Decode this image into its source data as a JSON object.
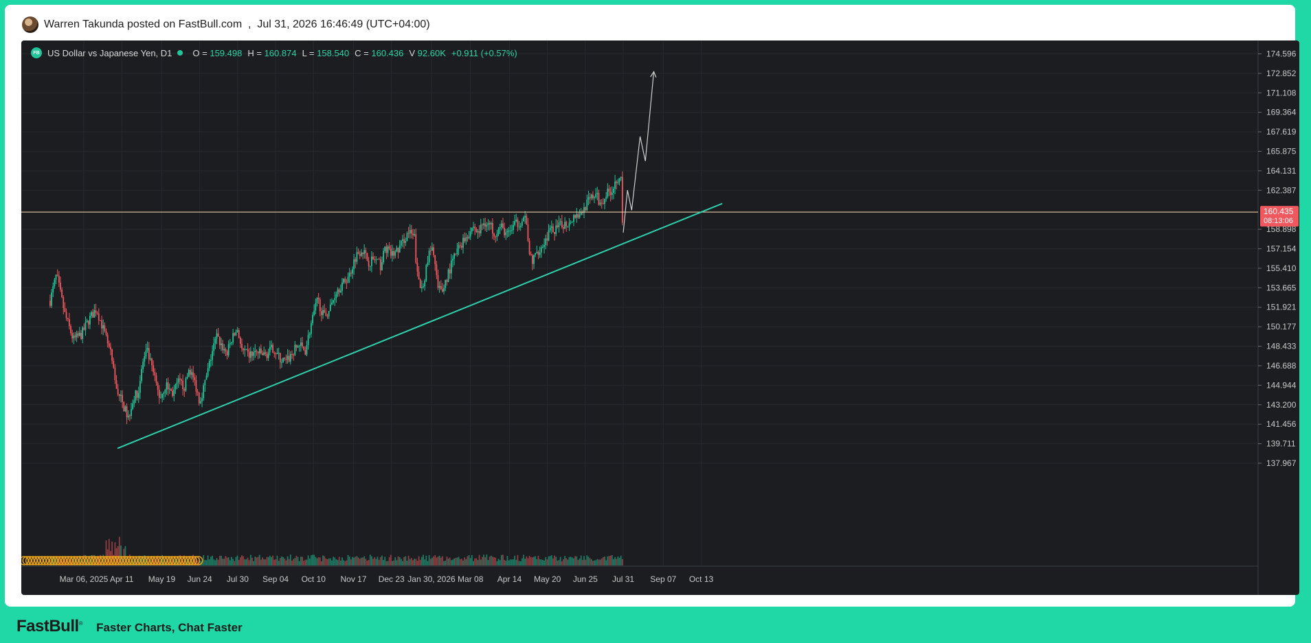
{
  "header": {
    "post_line": "Warren Takunda posted on FastBull.com  ,  Jul 31, 2026 16:46:49 (UTC+04:00)"
  },
  "legend": {
    "badge": "FB",
    "symbol": "US Dollar vs Japanese Yen, D1",
    "o_label": "O =",
    "o_value": "159.498",
    "h_label": "H =",
    "h_value": "160.874",
    "l_label": "L =",
    "l_value": "158.540",
    "c_label": "C =",
    "c_value": "160.436",
    "v_label": "V",
    "v_value": "92.60K",
    "change": "+0.911 (+0.57%)"
  },
  "footer": {
    "brand": "FastBull",
    "brand_mark": "®",
    "tagline": "Faster Charts, Chat Faster"
  },
  "colors": {
    "up": "#22c69a",
    "down": "#f0585f",
    "background": "#1b1d21",
    "price_line": "#e8c9a0",
    "trendline": "#2ed3ad",
    "projection": "#d0d0d0",
    "label_bg": "#f0585f"
  },
  "chart_data": {
    "type": "candlestick",
    "symbol": "US Dollar vs Japanese Yen",
    "timeframe": "D1",
    "ylim": [
      136.8,
      175.3
    ],
    "y_ticks": [
      "174.596",
      "172.852",
      "171.108",
      "169.364",
      "167.619",
      "165.875",
      "164.131",
      "162.387",
      "158.898",
      "157.154",
      "155.410",
      "153.665",
      "151.921",
      "150.177",
      "148.433",
      "146.688",
      "144.944",
      "143.200",
      "141.456",
      "139.711",
      "137.967"
    ],
    "x_ticks": [
      "Mar 06, 2025",
      "Apr 11",
      "May 19",
      "Jun 24",
      "Jul 30",
      "Sep 04",
      "Oct 10",
      "Nov 17",
      "Dec 23",
      "Jan 30, 2026",
      "Mar 08",
      "Apr 14",
      "May 20",
      "Jun 25",
      "Jul 31",
      "Sep 07",
      "Oct 13"
    ],
    "x_tick_offsets_days": [
      0,
      36,
      74,
      110,
      146,
      182,
      218,
      256,
      292,
      330,
      367,
      404,
      440,
      476,
      512,
      550,
      586
    ],
    "price_close_path": [
      {
        "d": -32,
        "p": 152.5
      },
      {
        "d": -26,
        "p": 154.8
      },
      {
        "d": -18,
        "p": 151.3
      },
      {
        "d": -10,
        "p": 149.0
      },
      {
        "d": -2,
        "p": 149.5
      },
      {
        "d": 4,
        "p": 150.7
      },
      {
        "d": 12,
        "p": 151.8
      },
      {
        "d": 20,
        "p": 149.5
      },
      {
        "d": 26,
        "p": 147.5
      },
      {
        "d": 30,
        "p": 145.0
      },
      {
        "d": 36,
        "p": 143.5
      },
      {
        "d": 42,
        "p": 142.0
      },
      {
        "d": 46,
        "p": 143.5
      },
      {
        "d": 52,
        "p": 144.5
      },
      {
        "d": 56,
        "p": 147.0
      },
      {
        "d": 60,
        "p": 148.0
      },
      {
        "d": 66,
        "p": 146.0
      },
      {
        "d": 72,
        "p": 143.8
      },
      {
        "d": 78,
        "p": 145.0
      },
      {
        "d": 84,
        "p": 144.2
      },
      {
        "d": 90,
        "p": 145.2
      },
      {
        "d": 96,
        "p": 144.8
      },
      {
        "d": 100,
        "p": 146.5
      },
      {
        "d": 106,
        "p": 145.0
      },
      {
        "d": 110,
        "p": 143.5
      },
      {
        "d": 116,
        "p": 145.5
      },
      {
        "d": 122,
        "p": 148.0
      },
      {
        "d": 126,
        "p": 149.3
      },
      {
        "d": 132,
        "p": 148.3
      },
      {
        "d": 136,
        "p": 147.8
      },
      {
        "d": 140,
        "p": 149.0
      },
      {
        "d": 146,
        "p": 150.0
      },
      {
        "d": 150,
        "p": 148.0
      },
      {
        "d": 156,
        "p": 147.6
      },
      {
        "d": 164,
        "p": 147.9
      },
      {
        "d": 172,
        "p": 147.6
      },
      {
        "d": 180,
        "p": 148.3
      },
      {
        "d": 186,
        "p": 147.3
      },
      {
        "d": 192,
        "p": 147.0
      },
      {
        "d": 198,
        "p": 147.8
      },
      {
        "d": 204,
        "p": 148.6
      },
      {
        "d": 210,
        "p": 148.0
      },
      {
        "d": 216,
        "p": 150.5
      },
      {
        "d": 222,
        "p": 152.6
      },
      {
        "d": 228,
        "p": 151.0
      },
      {
        "d": 234,
        "p": 151.9
      },
      {
        "d": 240,
        "p": 153.5
      },
      {
        "d": 246,
        "p": 154.0
      },
      {
        "d": 252,
        "p": 154.8
      },
      {
        "d": 258,
        "p": 156.5
      },
      {
        "d": 264,
        "p": 157.2
      },
      {
        "d": 270,
        "p": 156.0
      },
      {
        "d": 276,
        "p": 156.2
      },
      {
        "d": 282,
        "p": 155.6
      },
      {
        "d": 286,
        "p": 157.3
      },
      {
        "d": 292,
        "p": 156.6
      },
      {
        "d": 298,
        "p": 157.0
      },
      {
        "d": 304,
        "p": 158.0
      },
      {
        "d": 308,
        "p": 158.6
      },
      {
        "d": 314,
        "p": 158.1
      },
      {
        "d": 316,
        "p": 155.0
      },
      {
        "d": 320,
        "p": 153.5
      },
      {
        "d": 324,
        "p": 154.8
      },
      {
        "d": 328,
        "p": 156.8
      },
      {
        "d": 332,
        "p": 157.0
      },
      {
        "d": 336,
        "p": 153.5
      },
      {
        "d": 340,
        "p": 153.3
      },
      {
        "d": 346,
        "p": 155.0
      },
      {
        "d": 352,
        "p": 156.5
      },
      {
        "d": 358,
        "p": 157.6
      },
      {
        "d": 364,
        "p": 158.4
      },
      {
        "d": 370,
        "p": 159.2
      },
      {
        "d": 374,
        "p": 158.5
      },
      {
        "d": 380,
        "p": 159.6
      },
      {
        "d": 386,
        "p": 159.2
      },
      {
        "d": 390,
        "p": 158.6
      },
      {
        "d": 396,
        "p": 159.1
      },
      {
        "d": 402,
        "p": 158.4
      },
      {
        "d": 408,
        "p": 159.2
      },
      {
        "d": 414,
        "p": 159.6
      },
      {
        "d": 420,
        "p": 159.9
      },
      {
        "d": 422,
        "p": 156.8
      },
      {
        "d": 426,
        "p": 156.0
      },
      {
        "d": 430,
        "p": 156.9
      },
      {
        "d": 436,
        "p": 157.5
      },
      {
        "d": 442,
        "p": 158.7
      },
      {
        "d": 448,
        "p": 158.9
      },
      {
        "d": 454,
        "p": 159.3
      },
      {
        "d": 460,
        "p": 159.5
      },
      {
        "d": 466,
        "p": 160.2
      },
      {
        "d": 472,
        "p": 160.3
      },
      {
        "d": 476,
        "p": 161.0
      },
      {
        "d": 482,
        "p": 161.7
      },
      {
        "d": 486,
        "p": 162.1
      },
      {
        "d": 490,
        "p": 161.1
      },
      {
        "d": 496,
        "p": 162.1
      },
      {
        "d": 502,
        "p": 162.5
      },
      {
        "d": 506,
        "p": 163.5
      },
      {
        "d": 510,
        "p": 163.8
      },
      {
        "d": 511,
        "p": 158.9
      },
      {
        "d": 512,
        "p": 160.436
      }
    ],
    "volume_range": [
      0.0,
      1.0
    ],
    "last_price_label": "160.435",
    "countdown_label": "08:13:06",
    "current_price": 160.435,
    "trendline": {
      "start": {
        "d": 32,
        "p": 139.3
      },
      "end": {
        "d": 606,
        "p": 161.2
      }
    },
    "projection_path": [
      {
        "d": 512,
        "p": 158.6
      },
      {
        "d": 516,
        "p": 162.4
      },
      {
        "d": 520,
        "p": 160.6
      },
      {
        "d": 528,
        "p": 167.2
      },
      {
        "d": 533,
        "p": 165.0
      },
      {
        "d": 541,
        "p": 173.0
      }
    ]
  }
}
